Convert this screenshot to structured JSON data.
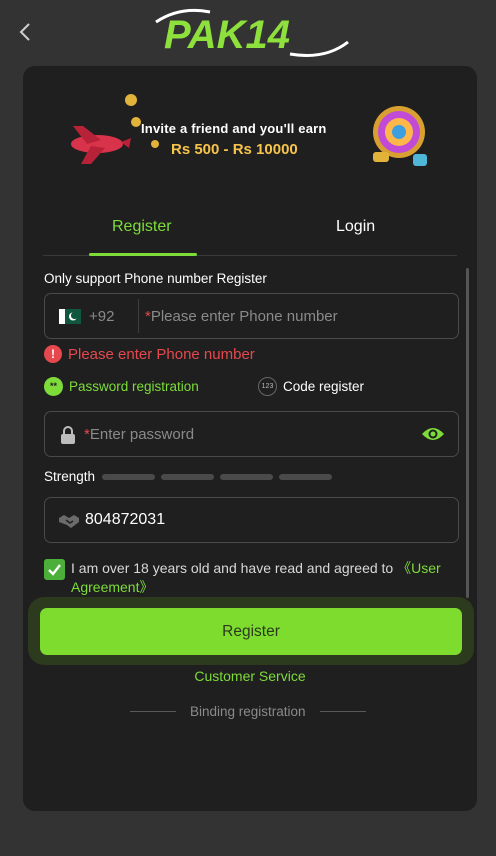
{
  "header": {
    "back_icon": "chevron-left-icon",
    "logo_text": "PAK14"
  },
  "banner": {
    "line1": "Invite a friend and you'll earn",
    "line2": "Rs 500 - Rs 10000"
  },
  "tabs": [
    {
      "label": "Register",
      "active": true
    },
    {
      "label": "Login",
      "active": false
    }
  ],
  "form": {
    "section_label": "Only support Phone number Register",
    "phone": {
      "country_code": "+92",
      "required_mark": "*",
      "placeholder": "Please enter Phone number"
    },
    "error_icon": "!",
    "error_text": "Please enter Phone number",
    "modes": {
      "password_label": "Password registration",
      "password_icon_text": "**",
      "code_label": "Code register",
      "code_icon_text": "123"
    },
    "password": {
      "required_mark": "*",
      "placeholder": "Enter password"
    },
    "strength_label": "Strength",
    "invite_code": "804872031",
    "agreement": {
      "text": "I am over 18 years old and have read and agreed to ",
      "link": "《User Agreement》",
      "checked": true
    },
    "register_button": "Register",
    "customer_service": "Customer Service",
    "binding": "Binding registration"
  },
  "colors": {
    "accent": "#7ddc3a",
    "error": "#e5484d",
    "background": "#333333",
    "card": "#1f1f1f"
  }
}
